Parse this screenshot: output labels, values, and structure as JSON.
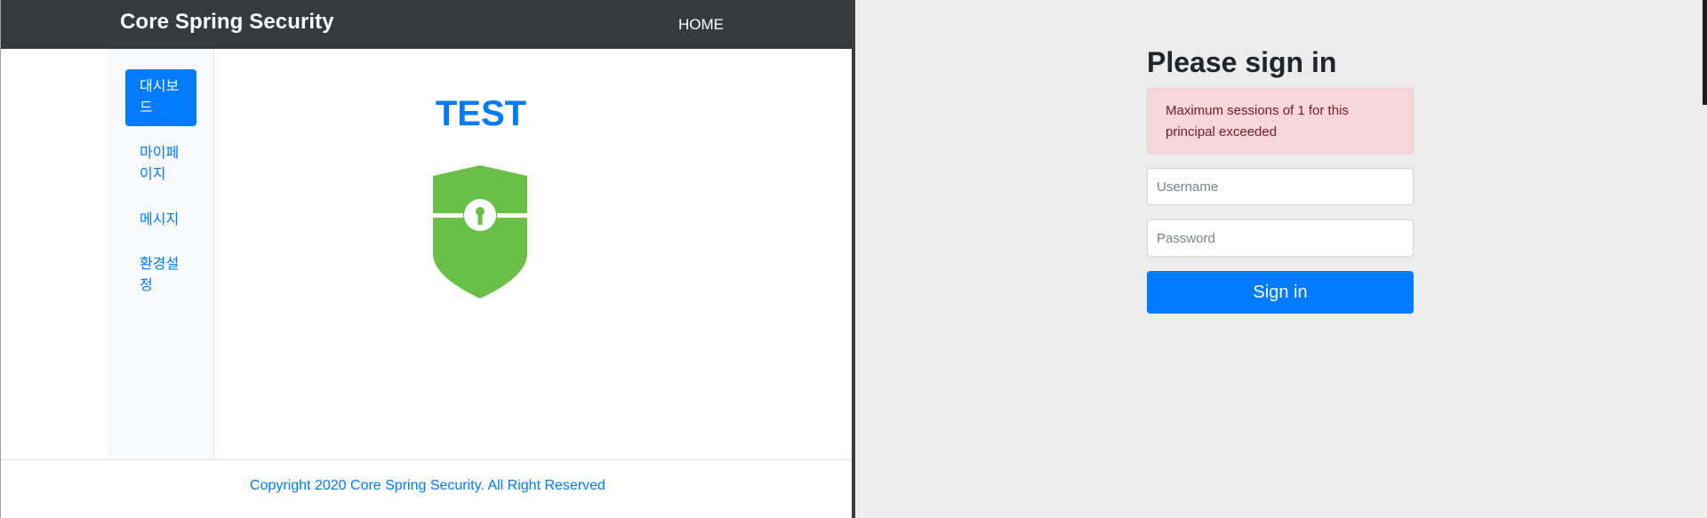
{
  "left": {
    "brand": "Core Spring Security",
    "nav": {
      "home": "HOME"
    },
    "sidebar": {
      "items": [
        {
          "label": "대시보드",
          "active": true
        },
        {
          "label": "마이페이지",
          "active": false
        },
        {
          "label": "메시지",
          "active": false
        },
        {
          "label": "환경설정",
          "active": false
        }
      ]
    },
    "content": {
      "title": "TEST",
      "icon": "shield-key-icon"
    },
    "footer": {
      "copyright": "Copyright 2020 Core Spring Security. All Right Reserved"
    }
  },
  "right": {
    "title": "Please sign in",
    "alert": "Maximum sessions of 1 for this principal exceeded",
    "username": {
      "placeholder": "Username",
      "value": ""
    },
    "password": {
      "placeholder": "Password",
      "value": ""
    },
    "submit": "Sign in"
  },
  "colors": {
    "navbar": "#343a40",
    "primary": "#007bff",
    "shield": "#6abf47",
    "alert_bg": "#f8d7da",
    "alert_text": "#721c24",
    "right_bg": "#ececec"
  }
}
